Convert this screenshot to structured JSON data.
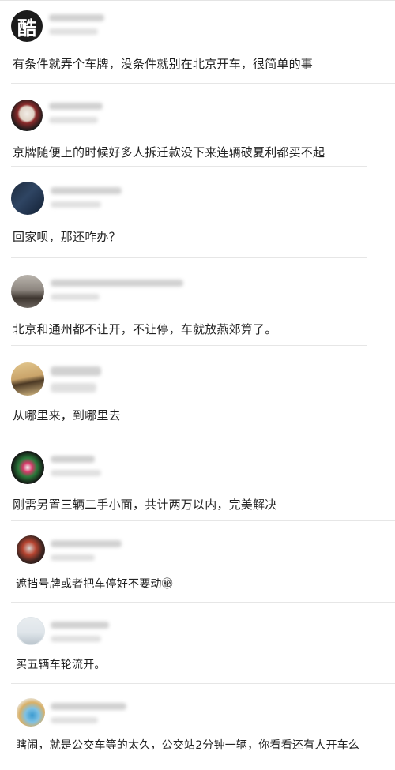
{
  "comments": [
    {
      "avatar_glyph": "酷",
      "text": "有条件就弄个车牌，没条件就别在北京开车，很简单的事"
    },
    {
      "text": "京牌随便上的时候好多人拆迁款没下来连辆破夏利都买不起"
    },
    {
      "text": "回家呗，那还咋办？"
    },
    {
      "text": "北京和通州都不让开，不让停，车就放燕郊算了。"
    },
    {
      "text": "从哪里来，到哪里去"
    },
    {
      "text": "刚需另置三辆二手小面，共计两万以内，完美解决"
    },
    {
      "text": "遮挡号牌或者把车停好不要动㊙"
    },
    {
      "text": "买五辆车轮流开。"
    },
    {
      "text": "瞎闹，就是公交车等的太久，公交站2分钟一辆，你看看还有人开车么"
    }
  ],
  "colors": {
    "text": "#222222",
    "divider": "#e6e6e6",
    "blur": "#c9c9c9"
  }
}
